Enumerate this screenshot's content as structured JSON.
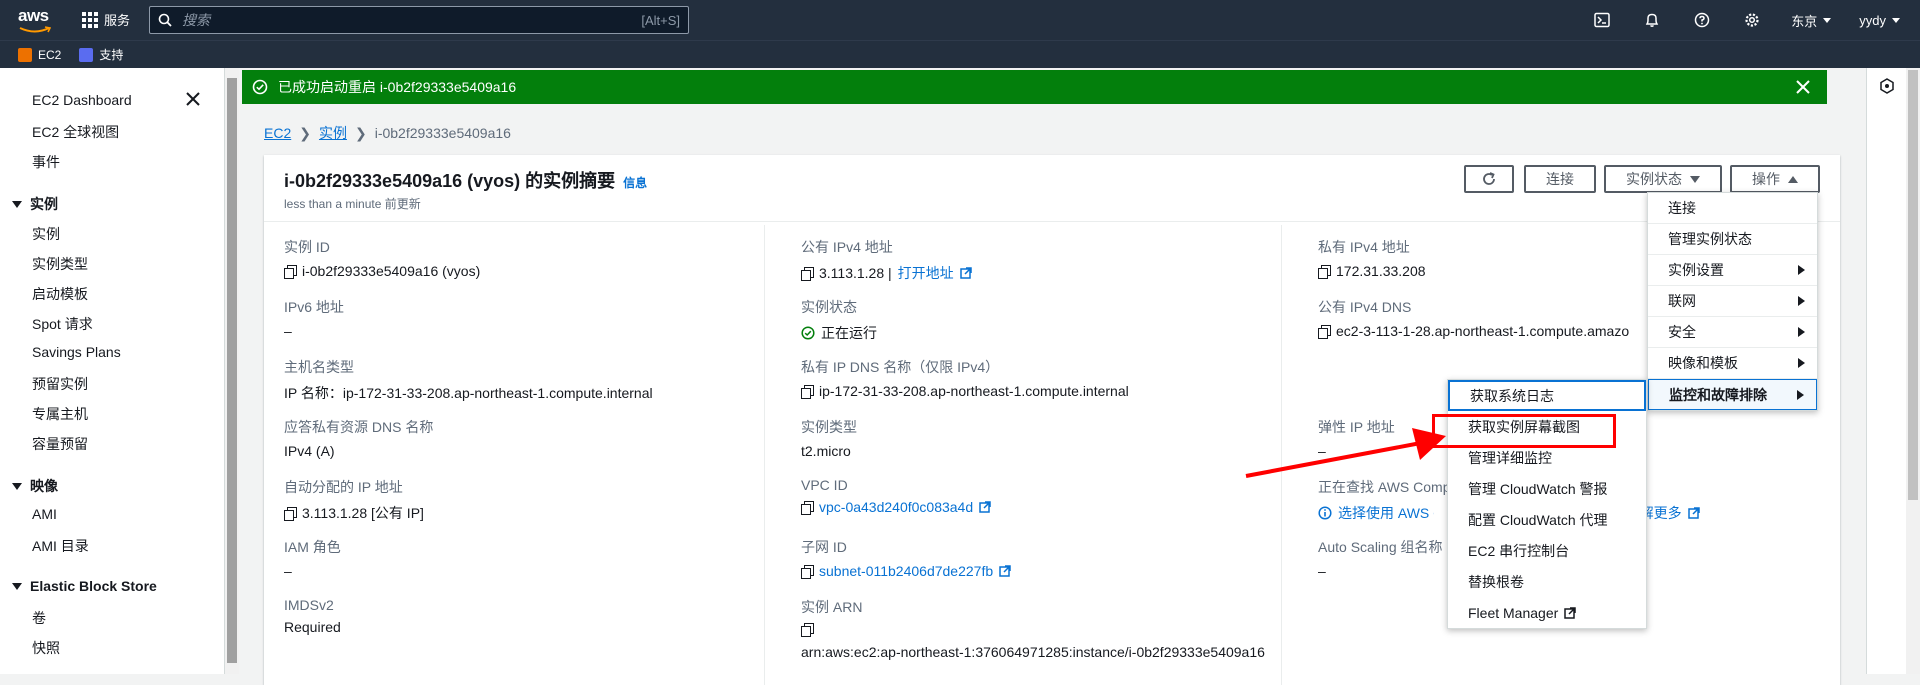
{
  "topbar": {
    "logo_text": "aws",
    "services_label": "服务",
    "search_placeholder": "搜索",
    "search_hint": "[Alt+S]",
    "region": "东京",
    "user": "yydy"
  },
  "favorites": [
    {
      "label": "EC2",
      "color": "#ed7100"
    },
    {
      "label": "支持",
      "color": "#5a6cf0"
    }
  ],
  "sidebar": {
    "top_links": [
      "EC2 Dashboard",
      "EC2 全球视图",
      "事件"
    ],
    "sections": [
      {
        "title": "实例",
        "items": [
          "实例",
          "实例类型",
          "启动模板",
          "Spot 请求",
          "Savings Plans",
          "预留实例",
          "专属主机",
          "容量预留"
        ]
      },
      {
        "title": "映像",
        "items": [
          "AMI",
          "AMI 目录"
        ]
      },
      {
        "title": "Elastic Block Store",
        "items": [
          "卷",
          "快照"
        ]
      }
    ]
  },
  "flash": {
    "message": "已成功启动重启 i-0b2f29333e5409a16"
  },
  "breadcrumb": {
    "root": "EC2",
    "middle": "实例",
    "current": "i-0b2f29333e5409a16"
  },
  "panel": {
    "title": "i-0b2f29333e5409a16 (vyos) 的实例摘要",
    "info": "信息",
    "subtitle": "less than a minute 前更新",
    "buttons": {
      "connect": "连接",
      "state": "实例状态",
      "actions": "操作"
    }
  },
  "col1": [
    {
      "label": "实例 ID",
      "value": "i-0b2f29333e5409a16 (vyos)",
      "copy": true
    },
    {
      "label": "IPv6 地址",
      "value": "–"
    },
    {
      "label": "主机名类型",
      "value": "IP 名称：ip-172-31-33-208.ap-northeast-1.compute.internal"
    },
    {
      "label": "应答私有资源 DNS 名称",
      "value": "IPv4 (A)"
    },
    {
      "label": "自动分配的 IP 地址",
      "value": "3.113.1.28 [公有 IP]",
      "copy": true
    },
    {
      "label": "IAM 角色",
      "value": "–"
    },
    {
      "label": "IMDSv2",
      "value": "Required"
    }
  ],
  "col2": [
    {
      "label": "公有 IPv4 地址",
      "value": "3.113.1.28 |",
      "link": "打开地址"
    },
    {
      "label": "实例状态",
      "value": "正在运行"
    },
    {
      "label": "私有 IP DNS 名称（仅限 IPv4）",
      "value": "ip-172-31-33-208.ap-northeast-1.compute.internal"
    },
    {
      "label": "实例类型",
      "value": "t2.micro"
    },
    {
      "label": "VPC ID",
      "value": "vpc-0a43d240f0c083a4d"
    },
    {
      "label": "子网 ID",
      "value": "subnet-011b2406d7de227fb"
    },
    {
      "label": "实例 ARN",
      "value": "arn:aws:ec2:ap-northeast-1:376064971285:instance/i-0b2f29333e5409a16"
    }
  ],
  "col3": [
    {
      "label": "私有 IPv4 地址",
      "value": "172.31.33.208"
    },
    {
      "label": "公有 IPv4 DNS",
      "value": "ec2-3-113-1-28.ap-northeast-1.compute.amazo"
    },
    {
      "label": "弹性 IP 地址",
      "value": "–"
    },
    {
      "label": "正在查找 AWS Comp",
      "value": "选择使用 AWS Co",
      "link": "了解更多"
    },
    {
      "label": "Auto Scaling 组名称",
      "value": "–"
    }
  ],
  "actions_menu": [
    {
      "label": "连接",
      "sub": false
    },
    {
      "label": "管理实例状态",
      "sub": false
    },
    {
      "label": "实例设置",
      "sub": true
    },
    {
      "label": "联网",
      "sub": true
    },
    {
      "label": "安全",
      "sub": true
    },
    {
      "label": "映像和模板",
      "sub": true
    },
    {
      "label": "监控和故障排除",
      "sub": true,
      "active": true
    }
  ],
  "submenu": [
    "获取系统日志",
    "获取实例屏幕截图",
    "管理详细监控",
    "管理 CloudWatch 警报",
    "配置 CloudWatch 代理",
    "EC2 串行控制台",
    "替换根卷",
    "Fleet Manager"
  ],
  "colors": {
    "accent": "#0972d3",
    "success": "#037f0c",
    "nav": "#232f3e",
    "annotation": "#ff0000"
  }
}
